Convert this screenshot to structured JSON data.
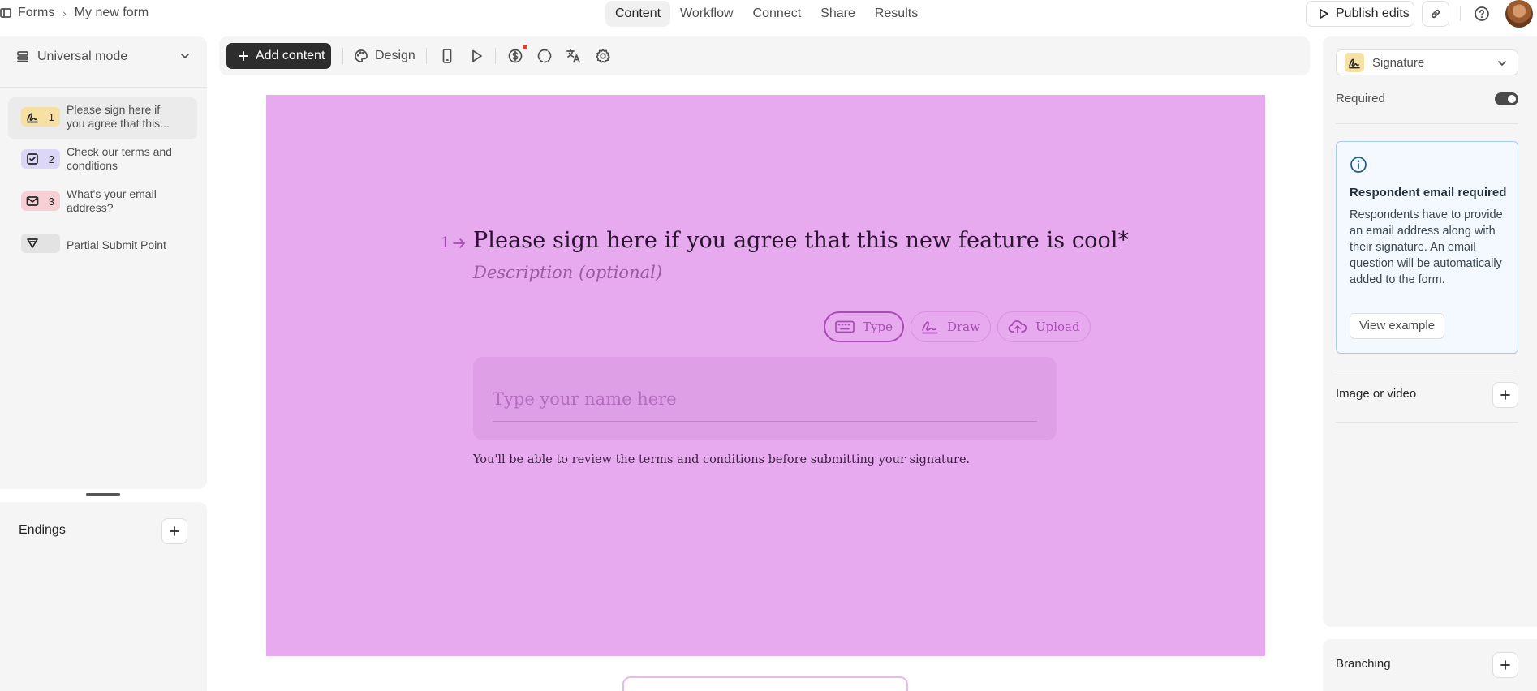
{
  "breadcrumb": {
    "root": "Forms",
    "current": "My new form"
  },
  "nav": {
    "tabs": [
      "Content",
      "Workflow",
      "Connect",
      "Share",
      "Results"
    ],
    "active": "Content"
  },
  "header": {
    "publish_label": "Publish edits"
  },
  "left": {
    "mode_label": "Universal mode",
    "questions": [
      {
        "num": "1",
        "type_icon": "signature-icon",
        "text": "Please sign here if you agree that this...",
        "active": true
      },
      {
        "num": "2",
        "type_icon": "checkbox-icon",
        "text": "Check our terms and conditions",
        "active": false
      },
      {
        "num": "3",
        "type_icon": "email-icon",
        "text": "What's your email address?",
        "active": false
      },
      {
        "num": "",
        "type_icon": "send-icon",
        "text": "Partial Submit Point",
        "active": false
      }
    ],
    "endings_label": "Endings"
  },
  "toolbar": {
    "add_label": "Add content",
    "design_label": "Design"
  },
  "canvas": {
    "background": "#e8aaef",
    "question_number": "1",
    "question_title": "Please sign here if you agree that this new feature is cool*",
    "description_placeholder": "Description (optional)",
    "signature_tabs": [
      "Type",
      "Draw",
      "Upload"
    ],
    "selected_tab": "Type",
    "name_placeholder": "Type your name here",
    "hint": "You'll be able to review the terms and conditions before submitting your signature."
  },
  "right": {
    "type_label": "Signature",
    "required_label": "Required",
    "required_on": true,
    "info_title": "Respondent email required",
    "info_text": "Respondents have to provide an email address along with their signature. An email question will be automatically added to the form.",
    "view_example_label": "View example",
    "image_label": "Image or video",
    "branching_label": "Branching"
  }
}
